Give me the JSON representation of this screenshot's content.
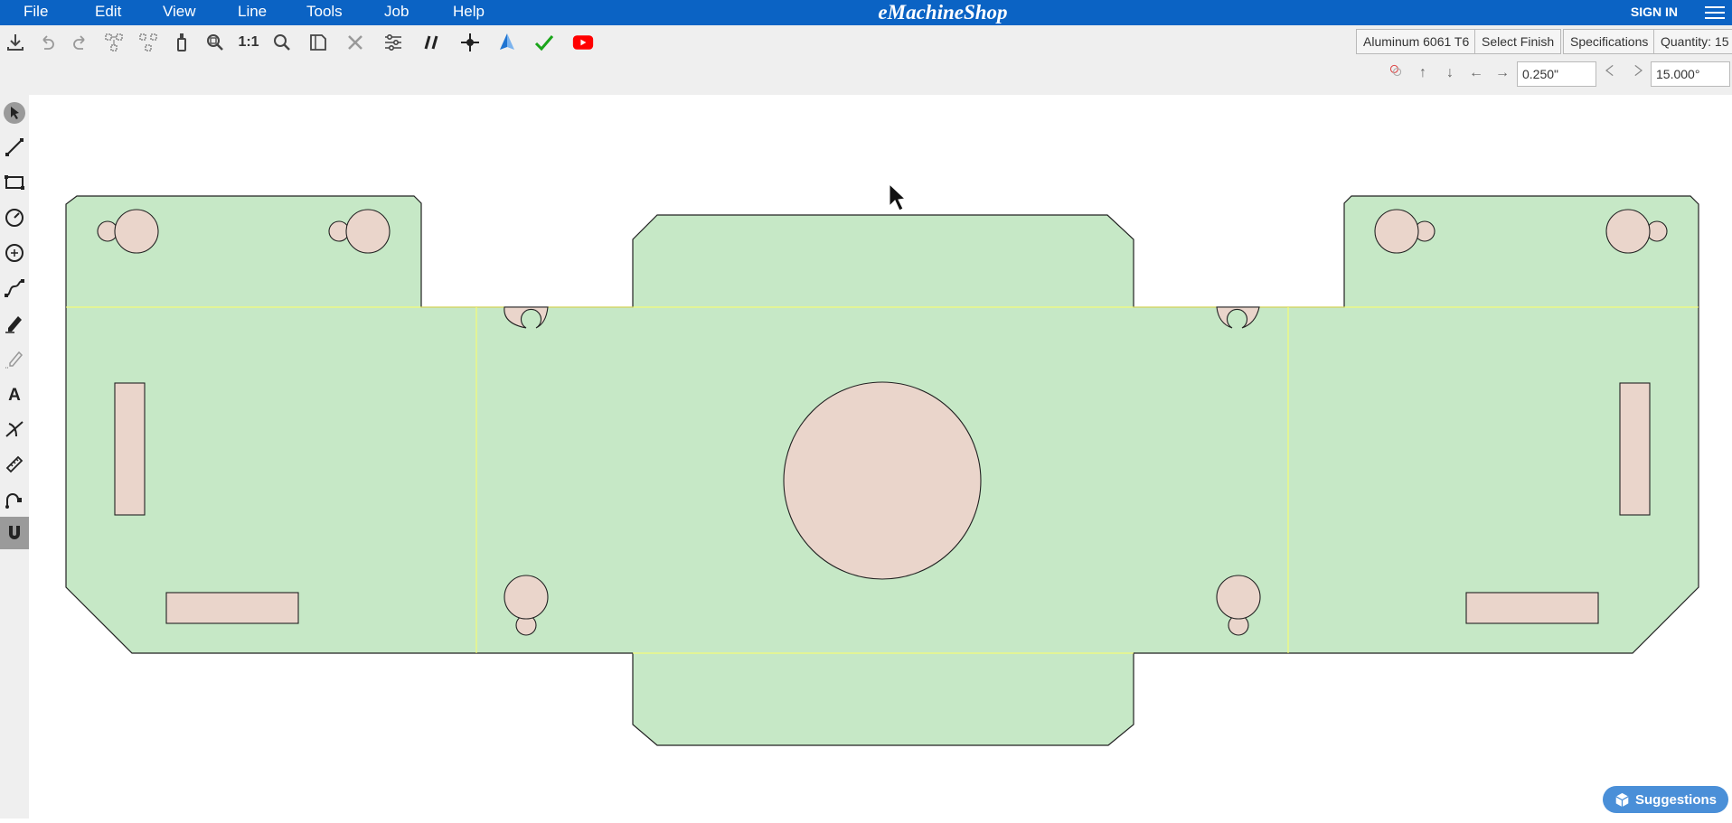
{
  "app": {
    "title": "eMachineShop",
    "sign_in": "SIGN IN"
  },
  "menu": [
    "File",
    "Edit",
    "View",
    "Line",
    "Tools",
    "Job",
    "Help"
  ],
  "toolbar": {
    "zoom_1to1": "1:1",
    "quote_buttons": {
      "material": "Aluminum 6061 T6",
      "finish": "Select Finish",
      "specifications": "Specifications",
      "quantity": "Quantity: 15"
    },
    "nudge": {
      "distance": "0.250\"",
      "angle": "15.000°"
    }
  },
  "palette": [
    "select-tool",
    "line-tool",
    "rectangle-tool",
    "circle-tool",
    "center-circle-tool",
    "curve-tool",
    "freehand-tool",
    "eraser-tool",
    "text-tool",
    "tangent-tool",
    "measure-tool",
    "route-tool",
    "snap-magnet-tool"
  ],
  "suggestions": {
    "label": "Suggestions"
  },
  "colors": {
    "menubar": "#0b63c4",
    "part_fill": "#c6e8c6",
    "hole_fill": "#ead5cb",
    "bend_line": "#ffff66",
    "youtube": "#ff0000",
    "check": "#1aa51a"
  }
}
